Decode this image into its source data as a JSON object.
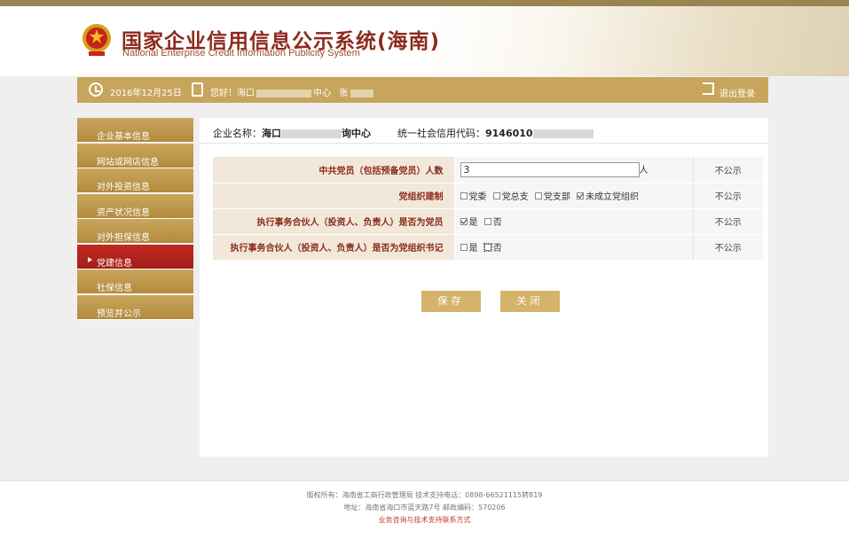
{
  "header": {
    "title_cn": "国家企业信用信息公示系统(海南)",
    "title_en": "National Enterprise Credit Information Publicity System"
  },
  "infobar": {
    "date": "2016年12月25日",
    "greeting_prefix": "您好！海口",
    "greeting_mid": "中心",
    "greeting_name": "张",
    "logout": "退出登录"
  },
  "sidebar": {
    "items": [
      {
        "label": "企业基本信息"
      },
      {
        "label": "网站或网店信息"
      },
      {
        "label": "对外投资信息"
      },
      {
        "label": "资产状况信息"
      },
      {
        "label": "对外担保信息"
      },
      {
        "label": "党建信息"
      },
      {
        "label": "社保信息"
      },
      {
        "label": "预览并公示"
      }
    ],
    "active_index": 5
  },
  "company": {
    "name_label": "企业名称：",
    "name_prefix": "海口",
    "name_suffix": "询中心",
    "code_label": "统一社会信用代码：",
    "code_prefix": "9146010"
  },
  "form": {
    "rows": [
      {
        "label": "中共党员（包括预备党员）人数",
        "value": "3",
        "unit": "人",
        "public": "不公示"
      },
      {
        "label": "党组织建制",
        "options": [
          "党委",
          "党总支",
          "党支部",
          "未成立党组织"
        ],
        "checked": [
          false,
          false,
          false,
          true
        ],
        "public": "不公示"
      },
      {
        "label": "执行事务合伙人（投资人、负责人）是否为党员",
        "options": [
          "是",
          "否"
        ],
        "checked": [
          true,
          false
        ],
        "public": "不公示"
      },
      {
        "label": "执行事务合伙人（投资人、负责人）是否为党组织书记",
        "options": [
          "是",
          "否"
        ],
        "checked": [
          false,
          false
        ],
        "public": "不公示"
      }
    ]
  },
  "buttons": {
    "save": "保存",
    "close": "关闭"
  },
  "footer": {
    "line1": "版权所有：海南省工商行政管理局 技术支持电话：0898-66521115转819",
    "line2": "地址：海南省海口市蓝天路7号 邮政编码：570206",
    "line3": "业务咨询与技术支持联系方式"
  },
  "colors": {
    "gold": "#c7a55c",
    "active_red": "#b52520",
    "title_red": "#8d2a1c"
  }
}
